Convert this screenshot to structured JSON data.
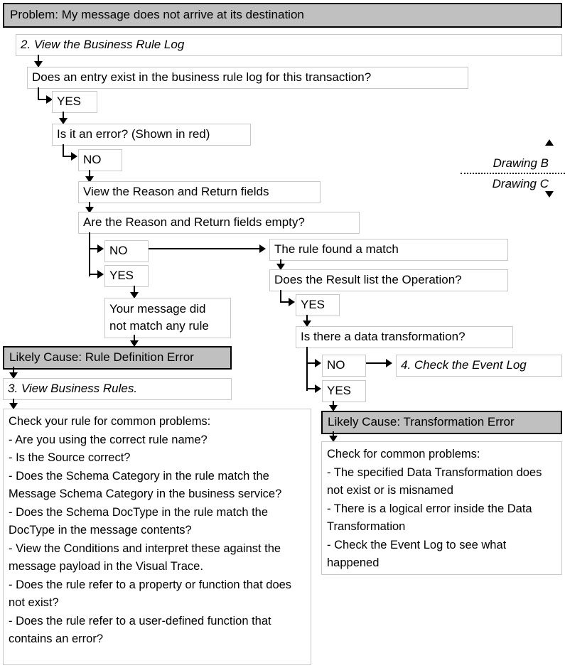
{
  "title_bar": {
    "label": "Problem: My message does not arrive at its destination"
  },
  "divider": {
    "upper_label": "Drawing B",
    "lower_label": "Drawing C",
    "up_arrow_icon": "arrow-up-icon",
    "down_arrow_icon": "arrow-down-icon"
  },
  "nodes": {
    "view_rule_log": "2. View the Business Rule Log",
    "entry_exists": "Does an entry exist in the business rule log for this transaction?",
    "entry_yes": "YES",
    "is_error": "Is it an error? (Shown in red)",
    "error_no": "NO",
    "view_reason_return": "View the Reason and Return fields",
    "fields_empty": "Are the Reason and Return fields empty?",
    "empty_no": "NO",
    "empty_yes": "YES",
    "no_match": "Your message did\nnot match any  rule",
    "cause_rule_definition": "Likely Cause: Rule Definition Error",
    "view_business_rules": "3. View Business Rules.",
    "rule_found_match": "The rule found a match",
    "result_lists_operation": "Does the Result list the Operation?",
    "operation_yes": "YES",
    "data_transformation": "Is there a data transformation?",
    "transform_no": "NO",
    "check_event_log": "4. Check the Event Log",
    "transform_yes": "YES",
    "cause_transformation": "Likely Cause: Transformation Error"
  },
  "left_checklist": {
    "heading": "Check your rule for common problems:",
    "items": [
      "- Are you using the correct rule name?",
      "- Is the Source correct?",
      "- Does the Schema Category in the rule match the Message Schema Category in the business service?",
      "- Does the Schema DocType in the rule match the DocType in the message contents?",
      "- View the Conditions and interpret these against the message payload in the Visual Trace.",
      "- Does the rule refer to a property or function that does not exist?",
      "- Does the rule refer to a user-defined function that contains an error?"
    ]
  },
  "right_checklist": {
    "heading": "Check for common problems:",
    "items": [
      "- The specified Data Transformation does not exist or is misnamed",
      "- There is a logical error inside the Data Transformation",
      "- Check the Event Log to see what happened"
    ]
  },
  "colors": {
    "header_fill": "#c0c0c0",
    "box_border": "#c8c8c8",
    "strong_border": "#000000",
    "connector": "#000000"
  }
}
